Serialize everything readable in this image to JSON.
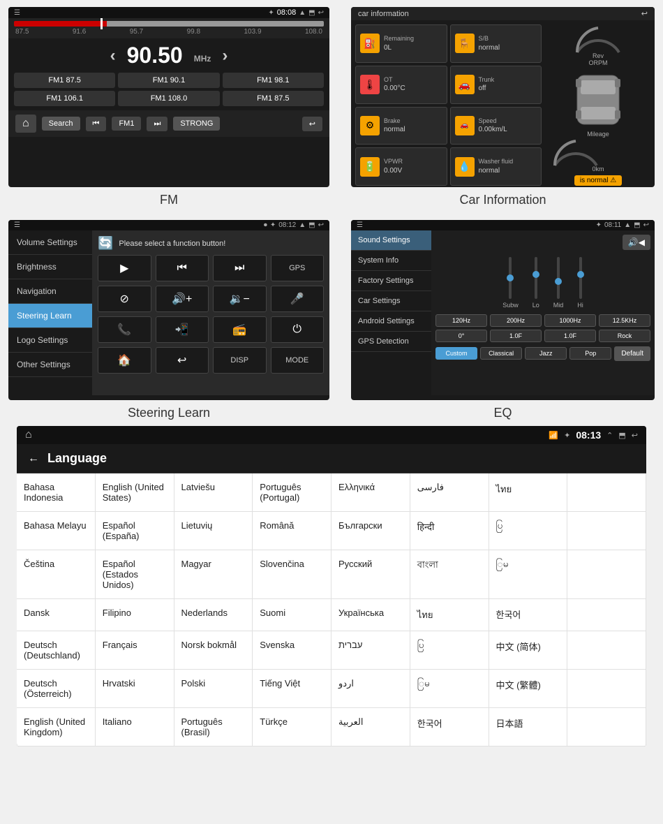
{
  "fm": {
    "label": "FM",
    "status_bar": {
      "left": "☰",
      "time": "08:08",
      "icons": "▲ ✦ ⬒ ↩"
    },
    "freq_min": "87.5",
    "freq_marks": [
      "87.5",
      "91.6",
      "95.7",
      "99.8",
      "103.9",
      "108.0"
    ],
    "freq_label": "FM1",
    "current_freq": "90.50",
    "mhz": "MHz",
    "presets": [
      [
        "FM1 87.5",
        "FM1 90.1",
        "FM1 98.1"
      ],
      [
        "FM1 106.1",
        "FM1 108.0",
        "FM1 87.5"
      ]
    ],
    "toolbar": {
      "home": "⌂",
      "search": "Search",
      "prev": "⏮",
      "fm1": "FM1",
      "next": "⏭",
      "strong": "STRONG",
      "back": "↩"
    }
  },
  "car_info": {
    "label": "Car Information",
    "header": "car information",
    "items": [
      {
        "icon": "⛽",
        "title": "Remaining",
        "value": "0L"
      },
      {
        "icon": "🪑",
        "title": "S/B",
        "value": "normal"
      },
      {
        "icon": "🌡️",
        "title": "OT",
        "value": "0.00°C"
      },
      {
        "icon": "🚗",
        "title": "Trunk",
        "value": "off"
      },
      {
        "icon": "⚙️",
        "title": "Brake",
        "value": "normal"
      },
      {
        "icon": "📊",
        "title": "Speed",
        "value": "0.00km/L"
      },
      {
        "icon": "🔋",
        "title": "VPWR",
        "value": "0.00V"
      },
      {
        "icon": "💧",
        "title": "Washer fluid",
        "value": "normal"
      }
    ],
    "gauge": {
      "label": "Rev\nORPM"
    },
    "mileage_label": "Mileage\n0km",
    "status_badge": "is normal ⚠️"
  },
  "steering_learn": {
    "label": "Steering Learn",
    "status_bar": {
      "left": "☰",
      "time": "08:12",
      "icons": "▲ ✦ ⬒ ↩"
    },
    "sidebar_items": [
      {
        "label": "Volume Settings",
        "active": false
      },
      {
        "label": "Brightness",
        "active": false
      },
      {
        "label": "Navigation",
        "active": false
      },
      {
        "label": "Steering Learn",
        "active": true
      },
      {
        "label": "Logo Settings",
        "active": false
      },
      {
        "label": "Other Settings",
        "active": false
      }
    ],
    "prompt": "Please select a function button!",
    "refresh_icon": "🔄",
    "buttons": [
      {
        "icon": "▶",
        "label": ""
      },
      {
        "icon": "⏮",
        "label": ""
      },
      {
        "icon": "⏭",
        "label": ""
      },
      {
        "label": "GPS"
      },
      {
        "icon": "🚫",
        "label": ""
      },
      {
        "icon": "🔊",
        "label": ""
      },
      {
        "icon": "🔈",
        "label": ""
      },
      {
        "icon": "🎤",
        "label": ""
      },
      {
        "icon": "📞",
        "label": ""
      },
      {
        "icon": "📱",
        "label": ""
      },
      {
        "icon": "📻",
        "label": ""
      },
      {
        "icon": "⏻",
        "label": ""
      },
      {
        "icon": "🏠",
        "label": ""
      },
      {
        "icon": "↩",
        "label": ""
      },
      {
        "label": "DISP"
      },
      {
        "label": "MODE"
      }
    ]
  },
  "eq": {
    "label": "EQ",
    "status_bar": {
      "left": "☰",
      "time": "08:11",
      "icons": "▲ ✦ ⬒ ↩"
    },
    "sidebar_items": [
      {
        "label": "Sound Settings",
        "active": true
      },
      {
        "label": "System Info",
        "active": false
      },
      {
        "label": "Factory Settings",
        "active": false
      },
      {
        "label": "Car Settings",
        "active": false
      },
      {
        "label": "Android Settings",
        "active": false
      },
      {
        "label": "GPS Detection",
        "active": false
      }
    ],
    "toggle_icon": "🔊",
    "sliders": [
      {
        "label": "Subw",
        "pos": 50
      },
      {
        "label": "Lo",
        "pos": 40
      },
      {
        "label": "Mid",
        "pos": 55
      },
      {
        "label": "Hi",
        "pos": 40
      }
    ],
    "freq_row": [
      "120Hz",
      "200Hz",
      "1000Hz",
      "12.5KHz"
    ],
    "val_row": [
      "0°",
      "1.0F",
      "1.0F",
      "Rock"
    ],
    "mode_row": [
      "Custom",
      "Classical",
      "Jazz",
      "Pop"
    ],
    "default_btn": "Default",
    "active_mode": "Custom"
  },
  "language": {
    "status_bar": {
      "home": "⌂",
      "signal": "📶",
      "bt": "✦",
      "time": "08:13",
      "expand": "⌃",
      "window": "⬒",
      "back": "↩"
    },
    "header": {
      "back": "←",
      "title": "Language"
    },
    "rows": [
      [
        "Bahasa Indonesia",
        "English (United States)",
        "Latviešu",
        "Português (Portugal)",
        "Ελληνικά",
        "فارسی",
        "ไทย",
        ""
      ],
      [
        "Bahasa Melayu",
        "Español (España)",
        "Lietuvių",
        "Română",
        "Български",
        "हिन्दी",
        "ပြ",
        ""
      ],
      [
        "Čeština",
        "Español (Estados Unidos)",
        "Magyar",
        "Slovenčina",
        "Русский",
        "বাংলা",
        "ြမ",
        ""
      ],
      [
        "Dansk",
        "Filipino",
        "Nederlands",
        "Suomi",
        "Українська",
        "ไทย",
        "한국어",
        ""
      ],
      [
        "Deutsch (Deutschland)",
        "Français",
        "Norsk bokmål",
        "Svenska",
        "עברית",
        "ပြ",
        "中文 (简体)",
        ""
      ],
      [
        "Deutsch (Österreich)",
        "Hrvatski",
        "Polski",
        "Tiếng Việt",
        "اردو",
        "ြမ",
        "中文 (繁體)",
        ""
      ],
      [
        "English (United Kingdom)",
        "Italiano",
        "Português (Brasil)",
        "Türkçe",
        "العربية",
        "한국어",
        "日本語",
        ""
      ]
    ]
  }
}
